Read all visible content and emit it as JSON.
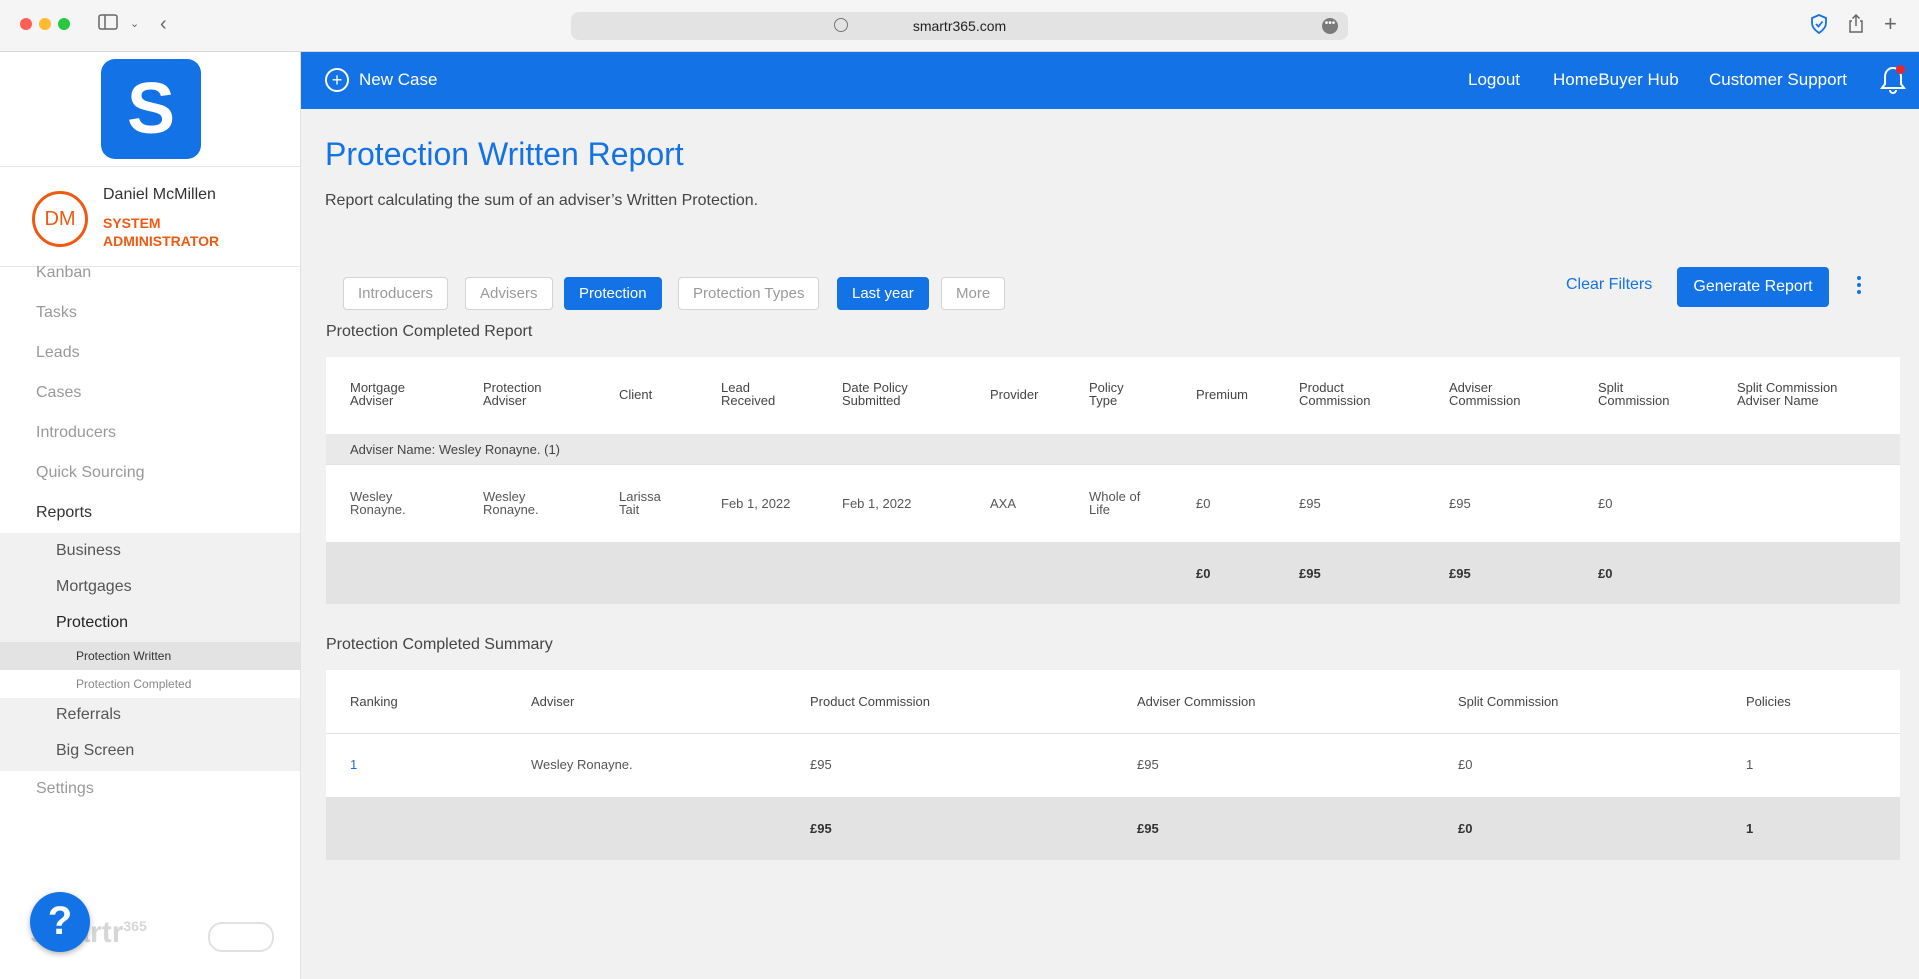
{
  "browser": {
    "url": "smartr365.com"
  },
  "sidebar": {
    "logo_letter": "S",
    "user": {
      "initials": "DM",
      "name": "Daniel McMillen",
      "role": "SYSTEM ADMINISTRATOR"
    },
    "nav": [
      "Kanban",
      "Tasks",
      "Leads",
      "Cases",
      "Introducers",
      "Quick Sourcing",
      "Reports"
    ],
    "reports_sub": [
      "Business",
      "Mortgages",
      "Protection",
      "Referrals",
      "Big Screen"
    ],
    "protection_sub": [
      "Protection Written",
      "Protection Completed"
    ],
    "settings": "Settings",
    "help": "?",
    "footer_brand": "smartr",
    "footer_brand_sup": "365"
  },
  "topbar": {
    "new_case": "New Case",
    "links": [
      "Logout",
      "HomeBuyer Hub",
      "Customer Support"
    ]
  },
  "page": {
    "title": "Protection Written Report",
    "description": "Report calculating the sum of an adviser’s Written Protection."
  },
  "filters": {
    "chips": [
      "Introducers",
      "Advisers",
      "Protection",
      "Protection Types",
      "Last year",
      "More"
    ],
    "clear": "Clear Filters",
    "generate": "Generate Report"
  },
  "report": {
    "title": "Protection Completed Report",
    "headers": [
      [
        "Mortgage",
        "Adviser"
      ],
      [
        "Protection",
        "Adviser"
      ],
      [
        "Client",
        ""
      ],
      [
        "Lead",
        "Received"
      ],
      [
        "Date Policy",
        "Submitted"
      ],
      [
        "Provider",
        ""
      ],
      [
        "Policy",
        "Type"
      ],
      [
        "Premium",
        ""
      ],
      [
        "Product",
        "Commission"
      ],
      [
        "Adviser",
        "Commission"
      ],
      [
        "Split",
        "Commission"
      ],
      [
        "Split Commission",
        "Adviser Name"
      ]
    ],
    "group_label": "Adviser Name: Wesley Ronayne. (1)",
    "rows": [
      {
        "cells": [
          [
            "Wesley",
            "Ronayne."
          ],
          [
            "Wesley",
            "Ronayne."
          ],
          [
            "Larissa",
            "Tait"
          ],
          [
            "Feb 1, 2022",
            ""
          ],
          [
            "Feb 1, 2022",
            ""
          ],
          [
            "AXA",
            ""
          ],
          [
            "Whole of",
            "Life"
          ],
          [
            "£0",
            ""
          ],
          [
            "£95",
            ""
          ],
          [
            "£95",
            ""
          ],
          [
            "£0",
            ""
          ],
          [
            "",
            ""
          ]
        ]
      }
    ],
    "totals": {
      "premium": "£0",
      "product_commission": "£95",
      "adviser_commission": "£95",
      "split_commission": "£0"
    }
  },
  "summary": {
    "title": "Protection Completed Summary",
    "headers": [
      "Ranking",
      "Adviser",
      "Product Commission",
      "Adviser Commission",
      "Split Commission",
      "Policies"
    ],
    "rows": [
      [
        "1",
        "Wesley Ronayne.",
        "£95",
        "£95",
        "£0",
        "1"
      ]
    ],
    "totals": [
      "",
      "",
      "£95",
      "£95",
      "£0",
      "1"
    ]
  },
  "colors": {
    "brand_blue": "#1373e6",
    "accent_orange": "#ef5a13",
    "notification_red": "#e8262e"
  }
}
